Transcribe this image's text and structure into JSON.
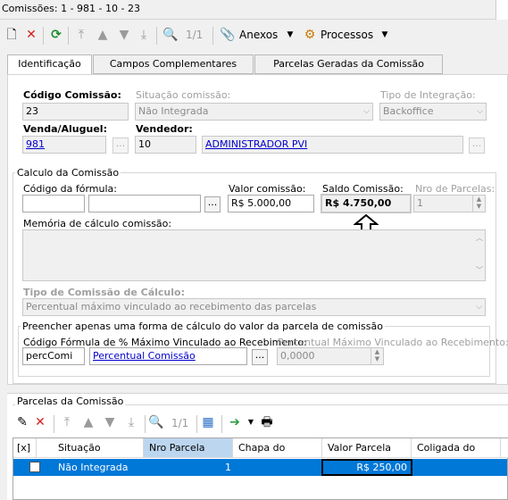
{
  "window": {
    "title": "Comissões: 1 - 981 - 10 - 23"
  },
  "toolbar": {
    "page": "1/1",
    "anexos": "Anexos",
    "processos": "Processos"
  },
  "tabs": [
    "Identificação",
    "Campos Complementares",
    "Parcelas Geradas da Comissão"
  ],
  "ident": {
    "codigo_label": "Código Comissão:",
    "codigo_value": "23",
    "situacao_label": "Situação comissão:",
    "situacao_value": "Não Integrada",
    "tipo_int_label": "Tipo de Integração:",
    "tipo_int_value": "Backoffice",
    "venda_label": "Venda/Aluguel:",
    "venda_value": "981",
    "vendedor_label": "Vendedor:",
    "vendedor_code": "10",
    "vendedor_name": "ADMINISTRADOR PVI"
  },
  "calculo": {
    "group_label": "Calculo da Comissão",
    "formula_label": "Código da fórmula:",
    "valor_label": "Valor comissão:",
    "valor_value": "R$ 5.000,00",
    "saldo_label": "Saldo Comissão:",
    "saldo_value": "R$ 4.750,00",
    "nro_label": "Nro de Parcelas:",
    "nro_value": "1",
    "memoria_label": "Memória de cálculo comissão:",
    "tipo_label": "Tipo de Comissão de Cálculo:",
    "tipo_value": "Percentual máximo vinculado ao recebimento das parcelas",
    "preencher_label": "Preencher apenas uma forma de cálculo do valor da parcela de comissão",
    "cod_formula_label": "Código Fórmula de % Máximo Vinculado ao Recebimento:",
    "cod_formula_code": "percComi",
    "cod_formula_name": "Percentual Comissão",
    "percentual_label": "Percentual Máximo Vinculado ao Recebimento:",
    "percentual_value": "0,0000"
  },
  "parcelas": {
    "group_label": "Parcelas da Comissão",
    "page": "1/1",
    "columns": [
      "[x]",
      "Situação",
      "Nro Parcela",
      "Chapa do",
      "Valor Parcela",
      "Coligada do"
    ],
    "rows": [
      {
        "situacao": "Não Integrada",
        "nro": "1",
        "chapa": "",
        "valor": "R$ 250,00",
        "coligada": ""
      }
    ]
  },
  "colors": {
    "selection": "#0078d7",
    "link": "#0000cc",
    "header_sel": "#bcd6ef"
  }
}
